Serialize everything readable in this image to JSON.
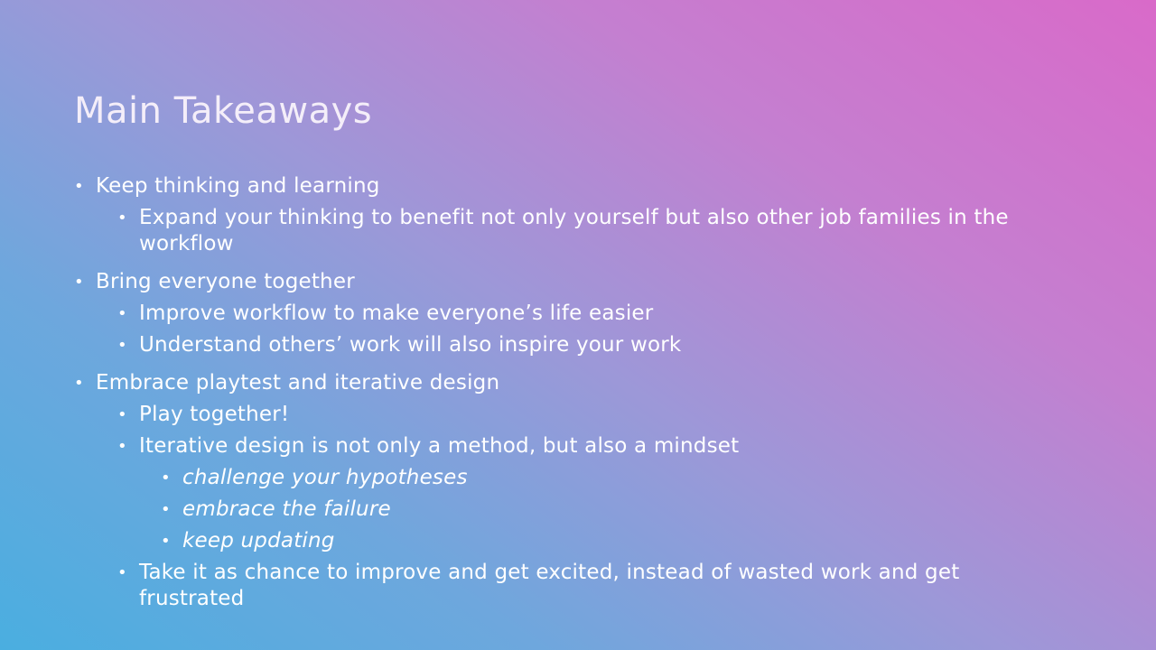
{
  "slide": {
    "title": "Main Takeaways",
    "bullet_glyph": "•",
    "sections": [
      {
        "text": "Keep thinking and learning",
        "subs": [
          "Expand your thinking to benefit not only yourself but also other job families in the workflow"
        ]
      },
      {
        "text": "Bring everyone together",
        "subs": [
          "Improve workflow to make everyone’s life easier",
          "Understand others’ work will also inspire your work"
        ]
      },
      {
        "text": "Embrace playtest and iterative design",
        "subs": [
          "Play together!",
          "Iterative design is not only a method, but also a mindset",
          "Take it as chance to improve and get excited, instead of wasted work and get frustrated"
        ],
        "subsubs": [
          "challenge your hypotheses",
          "embrace the failure",
          "keep updating"
        ]
      }
    ]
  }
}
